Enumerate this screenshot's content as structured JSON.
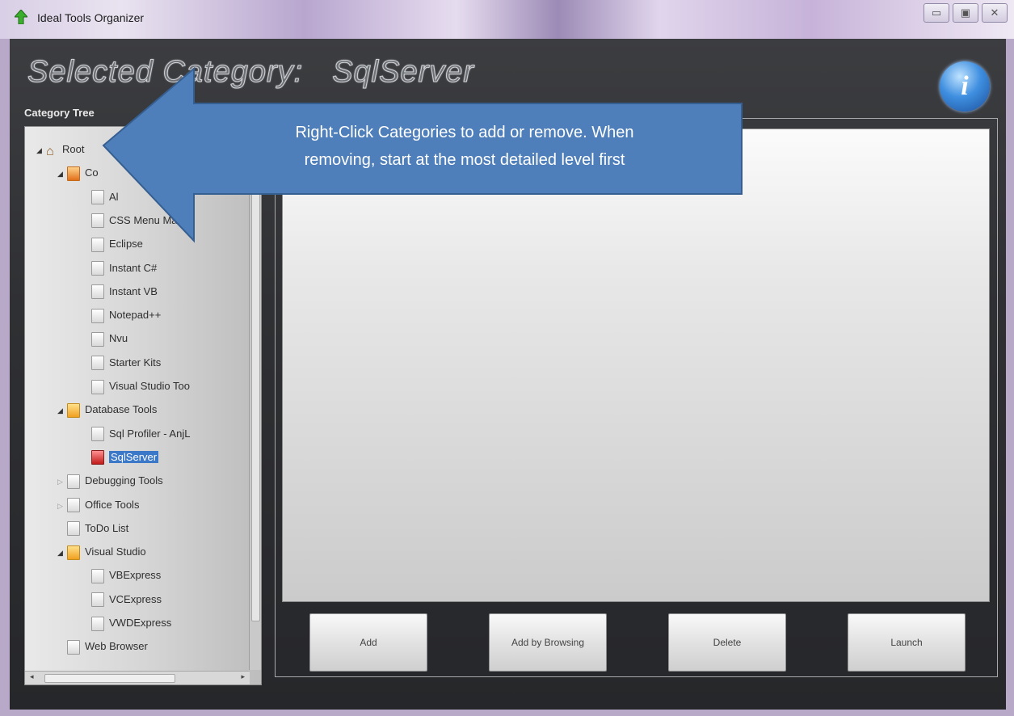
{
  "window": {
    "title": "Ideal Tools Organizer",
    "controls": [
      "▭",
      "▣",
      "✕"
    ]
  },
  "heading": {
    "prefix": "Selected Category:",
    "value": "SqlServer"
  },
  "tree": {
    "label": "Category Tree",
    "items": [
      {
        "label": "Root",
        "level": 0,
        "icon": "home-icon",
        "expanded": true
      },
      {
        "label": "Co",
        "level": 1,
        "icon": "folder-icon",
        "expanded": true
      },
      {
        "label": "Al",
        "level": 2,
        "icon": "file-icon"
      },
      {
        "label": "CSS Menu Maker",
        "level": 2,
        "icon": "file-icon"
      },
      {
        "label": "Eclipse",
        "level": 2,
        "icon": "file-icon"
      },
      {
        "label": "Instant C#",
        "level": 2,
        "icon": "file-icon"
      },
      {
        "label": "Instant VB",
        "level": 2,
        "icon": "file-icon"
      },
      {
        "label": "Notepad++",
        "level": 2,
        "icon": "file-icon"
      },
      {
        "label": "Nvu",
        "level": 2,
        "icon": "file-icon"
      },
      {
        "label": "Starter Kits",
        "level": 2,
        "icon": "file-icon"
      },
      {
        "label": "Visual Studio Too",
        "level": 2,
        "icon": "file-icon"
      },
      {
        "label": "Database Tools",
        "level": 1,
        "icon": "folder-icon",
        "expanded": true
      },
      {
        "label": "Sql Profiler - AnjL",
        "level": 2,
        "icon": "file-icon"
      },
      {
        "label": "SqlServer",
        "level": 2,
        "icon": "selected-file-icon",
        "selected": true
      },
      {
        "label": "Debugging Tools",
        "level": 1,
        "icon": "file-icon",
        "expandable": true
      },
      {
        "label": "Office Tools",
        "level": 1,
        "icon": "file-icon",
        "expandable": true
      },
      {
        "label": "ToDo List",
        "level": 1,
        "icon": "file-icon"
      },
      {
        "label": "Visual Studio",
        "level": 1,
        "icon": "folder-icon",
        "expanded": true
      },
      {
        "label": "VBExpress",
        "level": 2,
        "icon": "file-icon"
      },
      {
        "label": "VCExpress",
        "level": 2,
        "icon": "file-icon"
      },
      {
        "label": "VWDExpress",
        "level": 2,
        "icon": "file-icon"
      },
      {
        "label": "Web Browser",
        "level": 1,
        "icon": "file-icon"
      }
    ]
  },
  "buttons": {
    "add": "Add",
    "add_browse": "Add by Browsing",
    "delete": "Delete",
    "launch": "Launch"
  },
  "callout": {
    "line1": "Right-Click Categories  to add or remove. When",
    "line2": "removing, start at the most detailed level first"
  },
  "colors": {
    "callout_fill": "#4f7fba",
    "callout_border": "#365f91",
    "selection": "#3b78c8"
  }
}
